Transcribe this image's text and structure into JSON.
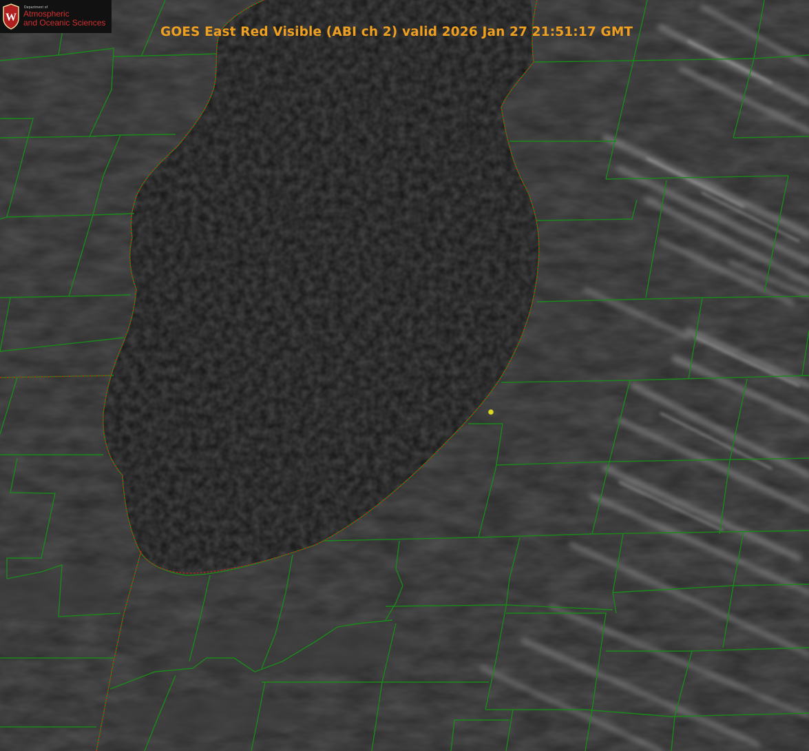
{
  "title": "GOES East Red Visible (ABI ch 2) valid 2026 Jan 27 21:51:17 GMT",
  "logo": {
    "department": "Department of",
    "line1": "Atmospheric",
    "line2": "and Oceanic Sciences",
    "crest_letter": "W"
  },
  "colors": {
    "boundary": "#1a8a1a",
    "shoreline": "#d01818",
    "title": "#f0a020",
    "marker": "#d8d820",
    "logo_text": "#d12f2f",
    "crest": "#b02020"
  },
  "icons": {
    "crest": "university-crest-icon",
    "marker": "location-dot-icon"
  }
}
